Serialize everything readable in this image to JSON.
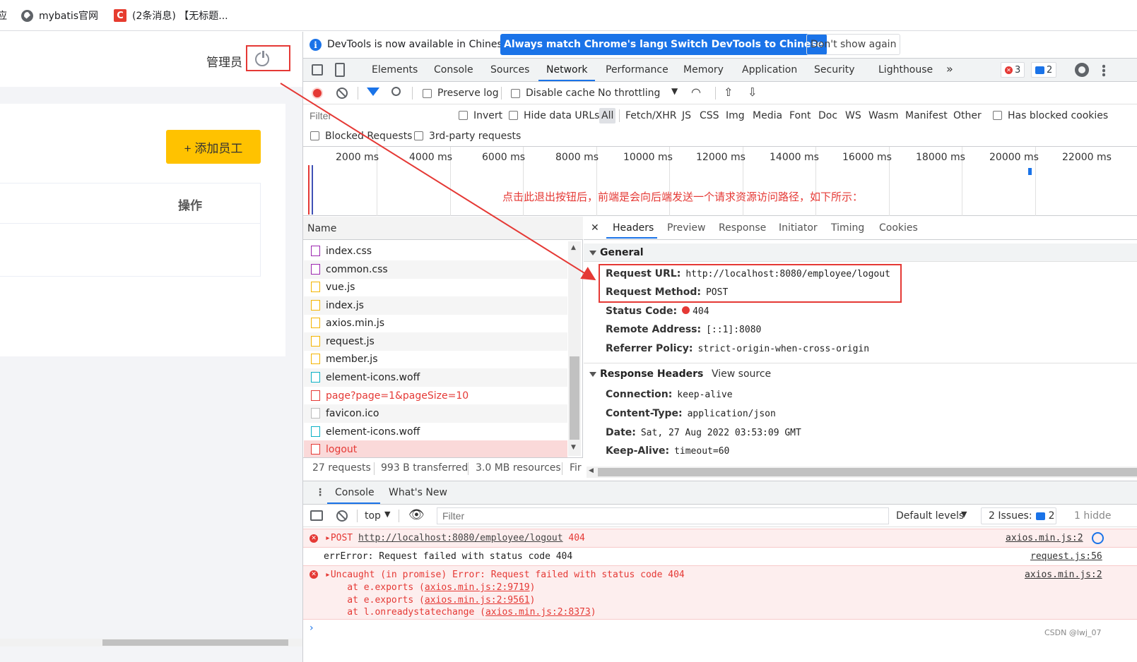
{
  "bookmarks": {
    "first_partial": "应",
    "items": [
      {
        "label": "mybatis官网",
        "icon": "globe-icon"
      },
      {
        "label": "(2条消息) 【无标题...",
        "icon": "csdn-icon",
        "icon_char": "C"
      }
    ]
  },
  "app": {
    "admin_label": "管理员",
    "add_button": "+ 添加员工",
    "table_column_ops": "操作",
    "accent": "#ffc200"
  },
  "devtools": {
    "info_bar": {
      "message": "DevTools is now available in Chinese!",
      "btn_match": "Always match Chrome's language",
      "btn_switch": "Switch DevTools to Chinese",
      "btn_dont_show": "Don't show again"
    },
    "tabs": [
      "Elements",
      "Console",
      "Sources",
      "Network",
      "Performance",
      "Memory",
      "Application",
      "Security",
      "Lighthouse"
    ],
    "active_tab": "Network",
    "more_tabs": "»",
    "error_count": "3",
    "message_count": "2",
    "toolbar": {
      "preserve_log": "Preserve log",
      "disable_cache": "Disable cache",
      "throttling": "No throttling"
    },
    "filter": {
      "placeholder": "Filter",
      "invert": "Invert",
      "hide_data_urls": "Hide data URLs",
      "types": [
        "All",
        "Fetch/XHR",
        "JS",
        "CSS",
        "Img",
        "Media",
        "Font",
        "Doc",
        "WS",
        "Wasm",
        "Manifest",
        "Other"
      ],
      "has_blocked_cookies": "Has blocked cookies",
      "blocked_requests": "Blocked Requests",
      "third_party": "3rd-party requests"
    },
    "timeline_ticks": [
      "2000 ms",
      "4000 ms",
      "6000 ms",
      "8000 ms",
      "10000 ms",
      "12000 ms",
      "14000 ms",
      "16000 ms",
      "18000 ms",
      "20000 ms",
      "22000 ms"
    ],
    "annotation": "点击此退出按钮后，前端是会向后端发送一个请求资源访问路径，如下所示：",
    "name_header": "Name",
    "requests": [
      {
        "name": "index.css",
        "type": "css",
        "status": "ok"
      },
      {
        "name": "common.css",
        "type": "css",
        "status": "ok"
      },
      {
        "name": "vue.js",
        "type": "js",
        "status": "ok"
      },
      {
        "name": "index.js",
        "type": "js",
        "status": "ok"
      },
      {
        "name": "axios.min.js",
        "type": "js",
        "status": "ok"
      },
      {
        "name": "request.js",
        "type": "js",
        "status": "ok"
      },
      {
        "name": "member.js",
        "type": "js",
        "status": "ok"
      },
      {
        "name": "element-icons.woff",
        "type": "font",
        "status": "ok"
      },
      {
        "name": "page?page=1&pageSize=10",
        "type": "doc",
        "status": "error"
      },
      {
        "name": "favicon.ico",
        "type": "other",
        "status": "ok"
      },
      {
        "name": "element-icons.woff",
        "type": "font",
        "status": "ok"
      },
      {
        "name": "logout",
        "type": "doc",
        "status": "selected-error"
      }
    ],
    "summary": {
      "requests": "27 requests",
      "transferred": "993 B transferred",
      "resources": "3.0 MB resources",
      "finish": "Fir"
    },
    "detail_tabs": [
      "Headers",
      "Preview",
      "Response",
      "Initiator",
      "Timing",
      "Cookies"
    ],
    "close_symbol": "✕",
    "general": {
      "title": "General",
      "request_url_k": "Request URL:",
      "request_url_v": "http://localhost:8080/employee/logout",
      "request_method_k": "Request Method:",
      "request_method_v": "POST",
      "status_code_k": "Status Code:",
      "status_code_v": "404",
      "remote_address_k": "Remote Address:",
      "remote_address_v": "[::1]:8080",
      "referrer_policy_k": "Referrer Policy:",
      "referrer_policy_v": "strict-origin-when-cross-origin"
    },
    "response_headers": {
      "title": "Response Headers",
      "view_source": "View source",
      "connection_k": "Connection:",
      "connection_v": "keep-alive",
      "content_type_k": "Content-Type:",
      "content_type_v": "application/json",
      "date_k": "Date:",
      "date_v": "Sat, 27 Aug 2022 03:53:09 GMT",
      "keep_alive_k": "Keep-Alive:",
      "keep_alive_v": "timeout=60"
    },
    "drawer": {
      "tab_console": "Console",
      "tab_whats_new": "What's New",
      "context": "top",
      "filter_placeholder": "Filter",
      "levels": "Default levels",
      "issues": "2 Issues:",
      "issues_count": "2",
      "hidden": "1 hidde",
      "logs": {
        "l1_method": "POST",
        "l1_url": "http://localhost:8080/employee/logout",
        "l1_status": "404",
        "l1_src": "axios.min.js:2",
        "l2_text": "errError: Request failed with status code 404",
        "l2_src": "request.js:56",
        "l3_text": "Uncaught (in promise) Error: Request failed with status code 404",
        "l3_src": "axios.min.js:2",
        "l3_at1_pre": "    at e.exports (",
        "l3_at1_link": "axios.min.js:2:9719",
        "l3_at2_pre": "    at e.exports (",
        "l3_at2_link": "axios.min.js:2:9561",
        "l3_at3_pre": "    at l.onreadystatechange (",
        "l3_at3_link": "axios.min.js:2:8373",
        "close_paren": ")"
      },
      "prompt": "›"
    },
    "watermark": "CSDN @lwj_07"
  },
  "colors": {
    "error": "#e53935",
    "link_blue": "#1a73e8"
  }
}
